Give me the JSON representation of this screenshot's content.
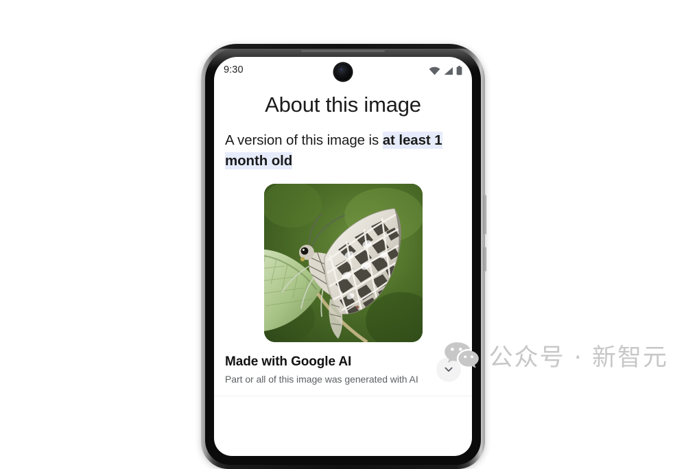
{
  "device": {
    "status_bar": {
      "time": "9:30",
      "icons": [
        "wifi-icon",
        "cellular-signal-icon",
        "battery-icon"
      ],
      "camera": "front-camera-punch-hole"
    }
  },
  "screen": {
    "page_title": "About this image",
    "version_notice": {
      "prefix": "A version of this image is ",
      "highlight": "at least 1 month old",
      "highlight_color": "#e6ecfb"
    },
    "photo": {
      "alt": "butterfly-on-leaf-photo",
      "colors": {
        "background_green": "#4a6b2a",
        "wing_light": "#e8e6df",
        "wing_dark": "#3b3a33",
        "leaf_green": "#b9cf9a"
      }
    },
    "ai_disclosure": {
      "title": "Made with Google AI",
      "subtitle": "Part or all of this image was generated with AI",
      "expand_icon": "chevron-down-icon"
    }
  },
  "watermark": {
    "icon": "wechat-logo-icon",
    "text": "公众号 · 新智元",
    "color": "#c7c7c7"
  }
}
